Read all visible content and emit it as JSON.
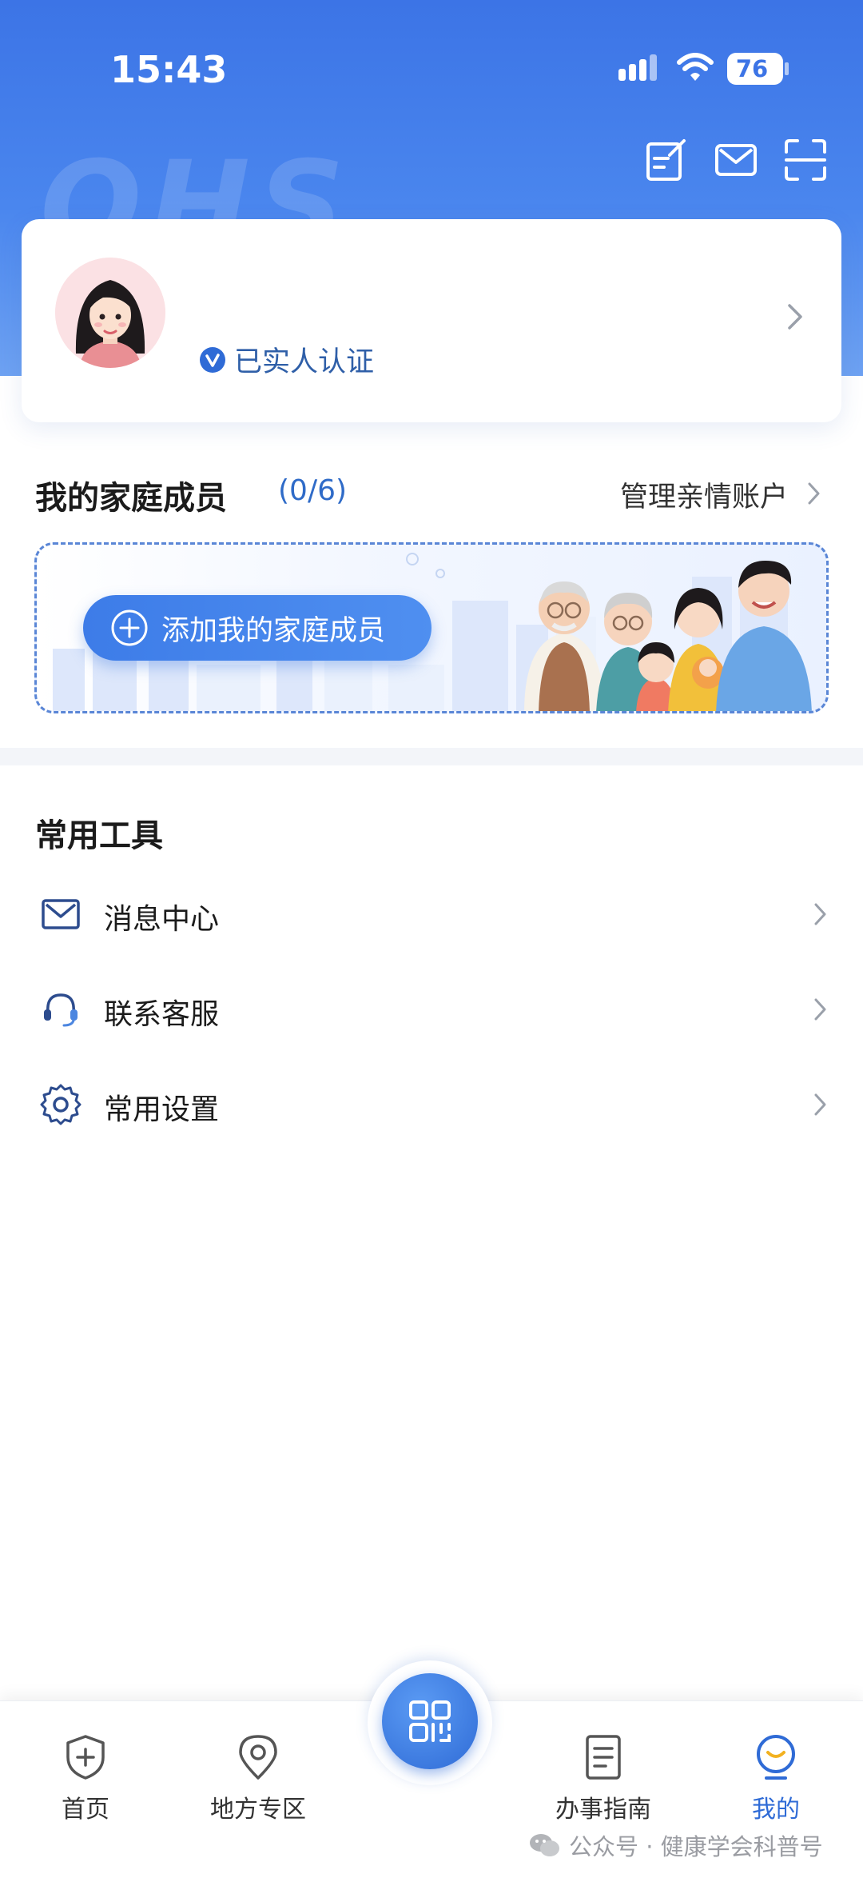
{
  "status_bar": {
    "time": "15:43",
    "battery": "76"
  },
  "header": {
    "watermark_text": "OHS"
  },
  "profile": {
    "verified_label": "已实人认证"
  },
  "family": {
    "title": "我的家庭成员",
    "count": "(0/6)",
    "manage_label": "管理亲情账户",
    "add_button_label": "添加我的家庭成员"
  },
  "tools": {
    "title": "常用工具",
    "items": [
      {
        "label": "消息中心",
        "icon": "mail-icon"
      },
      {
        "label": "联系客服",
        "icon": "headset-icon"
      },
      {
        "label": "常用设置",
        "icon": "gear-icon"
      }
    ]
  },
  "bottom_nav": {
    "items": [
      {
        "label": "首页",
        "icon": "shield-plus-icon"
      },
      {
        "label": "地方专区",
        "icon": "location-pin-icon"
      },
      {
        "label": "办事指南",
        "icon": "document-icon"
      },
      {
        "label": "我的",
        "icon": "smile-user-icon",
        "active": true
      }
    ],
    "center_icon": "qr-code-icon"
  },
  "watermark": {
    "text": "公众号 · 健康学会科普号"
  },
  "colors": {
    "primary": "#3c74e6",
    "accent_text": "#2f6bd6",
    "verified_text": "#2f5fa8"
  }
}
